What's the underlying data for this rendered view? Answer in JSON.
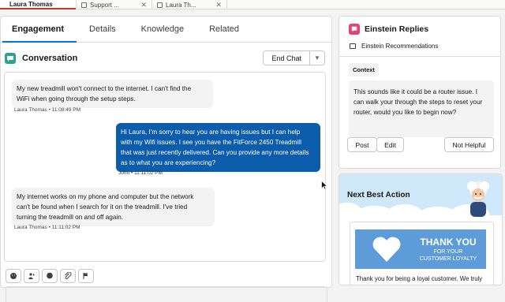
{
  "tabs": [
    {
      "label": "Laura Thomas"
    },
    {
      "label": "Support ..."
    },
    {
      "label": "Laura Th..."
    }
  ],
  "subtabs": [
    "Engagement",
    "Details",
    "Knowledge",
    "Related"
  ],
  "conversation": {
    "title": "Conversation",
    "end_chat": "End Chat",
    "messages": [
      {
        "text_lines": [
          "My new treadmill won't connect to the internet. I can't find the",
          "WiFi when going through the setup steps."
        ],
        "meta": "Laura Thomas • 11:08:49 PM"
      },
      {
        "text_lines": [
          "Hi Laura, I'm sorry to hear you are having issues but I can help",
          "with my Wifi issues. I see you have the FitForce 2450 Treadmill",
          "that was just recently delivered. Can you provide any more details",
          "as to what you are experiencing?"
        ],
        "meta": "John • 11:11:02 PM"
      },
      {
        "text_lines": [
          "My internet works on my phone and computer but the network",
          "can't be found when I search for it on the treadmill. I've tried",
          "turning the treadmill on and off again."
        ],
        "meta": "Laura Thomas • 11:11:02 PM"
      }
    ]
  },
  "einstein": {
    "title": "Einstein Replies",
    "subtitle": "Einstein Recommendations",
    "context_label": "Context",
    "context_lines": [
      "This sounds like it could be a router issue. I",
      "can walk your through the steps to reset your",
      "router, would you like to begin now?"
    ],
    "post": "Post",
    "edit": "Edit",
    "not_helpful": "Not Helpful"
  },
  "nba": {
    "title": "Next Best Action",
    "banner_title": "THANK YOU",
    "banner_sub_lines": [
      "FOR YOUR",
      "CUSTOMER LOYALTY"
    ],
    "description": "Thank you for being a loyal customer. We truly"
  },
  "colors": {
    "accent": "#0176d3",
    "agent_bubble": "#0b5cab",
    "conversation_icon": "#2aa58d",
    "einstein_icon": "#e3446f",
    "banner": "#5d9cd8"
  }
}
